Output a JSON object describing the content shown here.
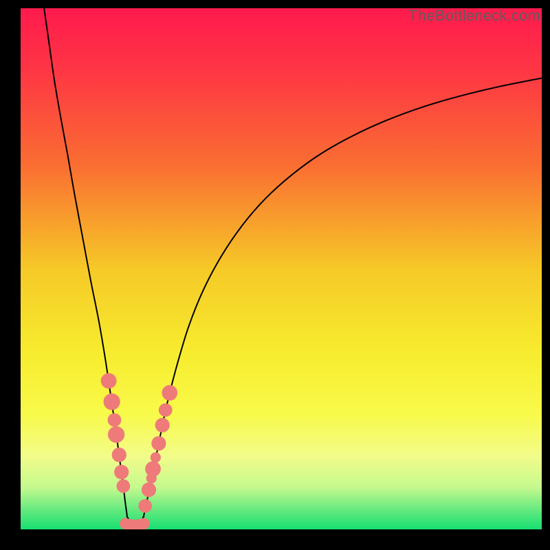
{
  "watermark": "TheBottleneck.com",
  "colors": {
    "frame": "#000000",
    "curve_stroke": "#000000",
    "marker_fill": "#ee7b79",
    "gradient_stops": [
      {
        "offset": 0.0,
        "color": "#ff1a4d"
      },
      {
        "offset": 0.12,
        "color": "#fe3644"
      },
      {
        "offset": 0.3,
        "color": "#fa6d32"
      },
      {
        "offset": 0.5,
        "color": "#f6c927"
      },
      {
        "offset": 0.66,
        "color": "#f7ec2e"
      },
      {
        "offset": 0.78,
        "color": "#f8fa4a"
      },
      {
        "offset": 0.86,
        "color": "#f2fc8a"
      },
      {
        "offset": 0.92,
        "color": "#c4f98e"
      },
      {
        "offset": 0.965,
        "color": "#5fe97e"
      },
      {
        "offset": 1.0,
        "color": "#17df72"
      }
    ]
  },
  "chart_data": {
    "type": "line",
    "title": "",
    "xlabel": "",
    "ylabel": "",
    "xlim": [
      0,
      100
    ],
    "ylim": [
      0,
      100
    ],
    "legend": false,
    "grid": false,
    "series": [
      {
        "name": "left-branch",
        "x": [
          4.5,
          5.5,
          6.5,
          7.7,
          9.0,
          10.4,
          11.9,
          13.4,
          15.0,
          16.2,
          17.1,
          17.9,
          18.6,
          19.2,
          19.7,
          20.1,
          20.45
        ],
        "y": [
          100,
          93,
          86,
          79,
          72,
          64,
          56,
          48,
          40,
          33,
          27,
          21.5,
          16.5,
          12,
          8.3,
          5.0,
          2.5
        ]
      },
      {
        "name": "valley-floor",
        "x": [
          20.45,
          21.2,
          22.0,
          22.8,
          23.6
        ],
        "y": [
          2.5,
          0.9,
          0.5,
          0.9,
          2.5
        ]
      },
      {
        "name": "right-branch",
        "x": [
          23.6,
          24.2,
          25.0,
          25.9,
          26.9,
          28.2,
          30.0,
          32.2,
          35.0,
          38.5,
          42.5,
          47.0,
          52.0,
          57.5,
          63.5,
          70.0,
          77.0,
          84.5,
          92.0,
          100.0
        ],
        "y": [
          2.5,
          5.3,
          9.0,
          13.5,
          18.5,
          24.5,
          31.5,
          38.8,
          45.8,
          52.4,
          58.3,
          63.5,
          68.0,
          72.0,
          75.4,
          78.4,
          81.0,
          83.2,
          85.0,
          86.6
        ]
      }
    ],
    "markers": {
      "name": "highlighted-points",
      "points": [
        {
          "x": 16.9,
          "y": 28.5,
          "r": 1.5
        },
        {
          "x": 17.5,
          "y": 24.5,
          "r": 1.6
        },
        {
          "x": 18.0,
          "y": 21.0,
          "r": 1.3
        },
        {
          "x": 18.35,
          "y": 18.2,
          "r": 1.6
        },
        {
          "x": 18.9,
          "y": 14.3,
          "r": 1.4
        },
        {
          "x": 19.35,
          "y": 11.0,
          "r": 1.4
        },
        {
          "x": 19.7,
          "y": 8.3,
          "r": 1.3
        },
        {
          "x": 20.1,
          "y": 1.1,
          "r": 1.1
        },
        {
          "x": 21.0,
          "y": 0.9,
          "r": 1.1
        },
        {
          "x": 21.9,
          "y": 0.8,
          "r": 1.1
        },
        {
          "x": 22.8,
          "y": 0.9,
          "r": 1.1
        },
        {
          "x": 23.7,
          "y": 1.1,
          "r": 1.1
        },
        {
          "x": 23.9,
          "y": 4.5,
          "r": 1.3
        },
        {
          "x": 24.6,
          "y": 7.6,
          "r": 1.4
        },
        {
          "x": 25.1,
          "y": 9.8,
          "r": 1.0
        },
        {
          "x": 25.4,
          "y": 11.6,
          "r": 1.5
        },
        {
          "x": 25.9,
          "y": 13.8,
          "r": 1.0
        },
        {
          "x": 26.5,
          "y": 16.5,
          "r": 1.4
        },
        {
          "x": 27.2,
          "y": 20.0,
          "r": 1.4
        },
        {
          "x": 27.8,
          "y": 22.9,
          "r": 1.3
        },
        {
          "x": 28.6,
          "y": 26.2,
          "r": 1.5
        }
      ]
    }
  }
}
